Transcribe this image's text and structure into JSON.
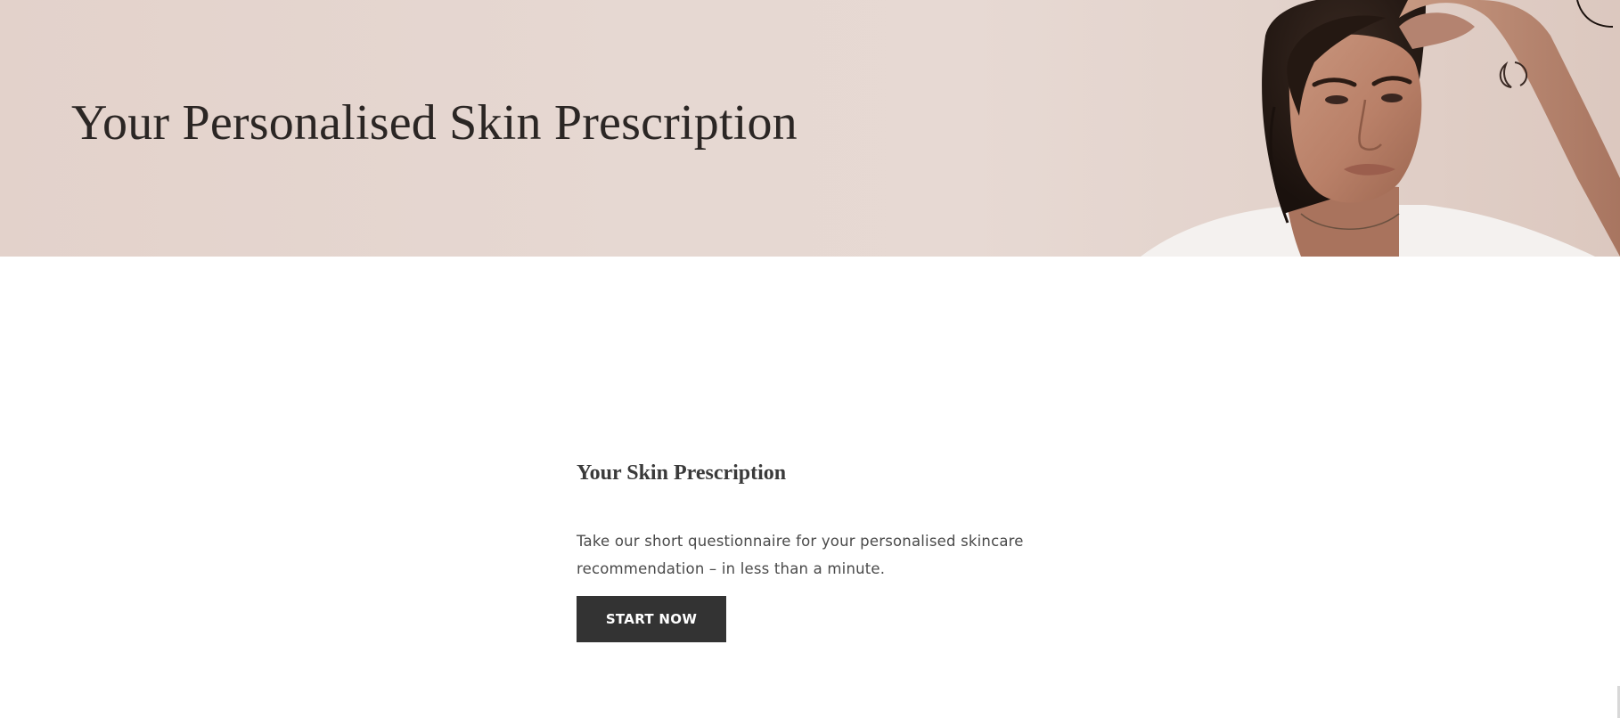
{
  "hero": {
    "title": "Your Personalised Skin Prescription",
    "background_color": "#e5d6d0",
    "image": "portrait-photo"
  },
  "section": {
    "heading": "Your Skin Prescription",
    "body": "Take our short questionnaire for your personalised skincare recommendation – in less than a minute.",
    "cta_label": "START NOW",
    "cta_color": "#333333"
  }
}
